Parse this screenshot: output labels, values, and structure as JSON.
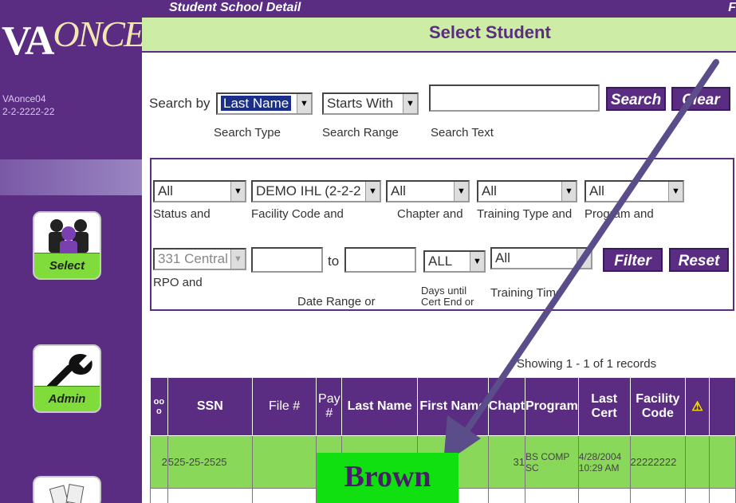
{
  "header": {
    "title": "Student School Detail",
    "right_text": "F",
    "section_title": "Select Student"
  },
  "sidebar": {
    "logo_main": "VA",
    "logo_script": "ONCE",
    "user": "VAonce04",
    "user_id": "2-2-2222-22",
    "nav": [
      {
        "label": "Select",
        "icon": "users-icon"
      },
      {
        "label": "Admin",
        "icon": "wrench-icon"
      }
    ]
  },
  "search": {
    "label": "Search by",
    "type_value": "Last Name",
    "type_caption": "Search Type",
    "range_value": "Starts With",
    "range_caption": "Search Range",
    "text_value": "",
    "text_caption": "Search Text",
    "search_button": "Search",
    "clear_button": "Clear"
  },
  "filters": {
    "status": {
      "value": "All",
      "caption": "Status and"
    },
    "facility": {
      "value": "DEMO IHL (2-2-2",
      "caption": "Facility Code and"
    },
    "chapter": {
      "value": "All",
      "caption": "Chapter and"
    },
    "training_type": {
      "value": "All",
      "caption": "Training Type and"
    },
    "program": {
      "value": "All",
      "caption": "Program and"
    },
    "rpo": {
      "value": "331 Central",
      "caption": "RPO and"
    },
    "date_from": "",
    "date_to_label": "to",
    "date_to": "",
    "date_caption": "Date Range or",
    "days_until": {
      "value": "ALL",
      "caption_line1": "Days until",
      "caption_line2": "Cert End or"
    },
    "training_time": {
      "value": "All",
      "caption": "Training Time"
    },
    "filter_button": "Filter",
    "reset_button": "Reset"
  },
  "results": {
    "showing_text": "Showing 1 - 1 of 1 records",
    "columns": [
      "SSN",
      "File #",
      "Pay #",
      "Last Name",
      "First Name",
      "Chapt",
      "Program",
      "Last Cert",
      "Facility Code",
      "⚠"
    ],
    "row": {
      "index": "2",
      "ssn": "525-25-2525",
      "file": "",
      "pay": "",
      "last_name": "",
      "first_name": "",
      "chapt": "31",
      "program": "BS COMP SC",
      "last_cert": "4/28/2004 10:29 AM",
      "facility_code": "22222222"
    }
  },
  "annotation": {
    "callout_text": "Brown",
    "callout_color": "#10e010",
    "arrow_color": "#5b4d8a"
  }
}
